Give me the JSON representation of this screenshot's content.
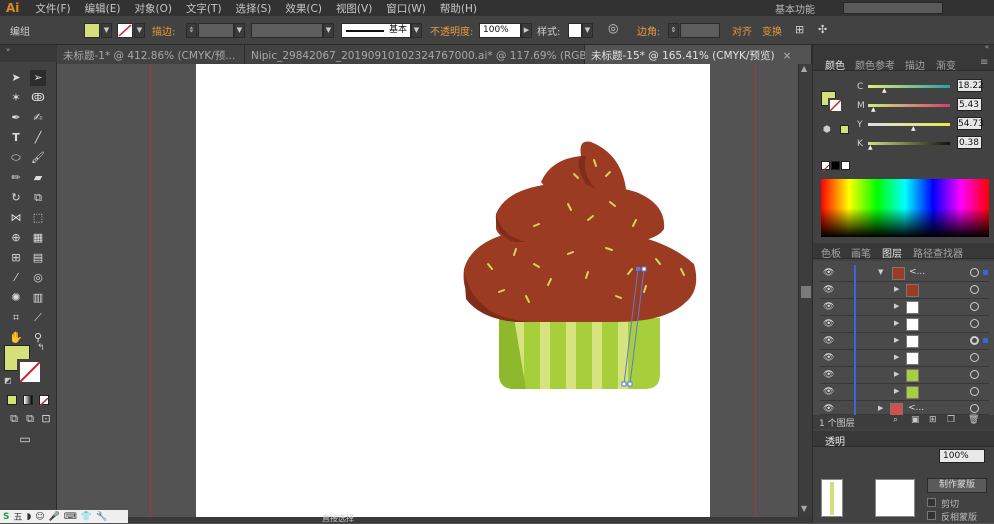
{
  "app": {
    "logo": "Ai",
    "workspace": "基本功能"
  },
  "menu": [
    "文件(F)",
    "编辑(E)",
    "对象(O)",
    "文字(T)",
    "选择(S)",
    "效果(C)",
    "视图(V)",
    "窗口(W)",
    "帮助(H)"
  ],
  "control": {
    "mode_label": "编组",
    "stroke_label": "描边:",
    "stroke_style": "基本",
    "opacity_label": "不透明度:",
    "opacity_value": "100%",
    "style_label": "样式:",
    "corner_label": "边角:",
    "align_label": "对齐",
    "transform_label": "变换"
  },
  "tabs": [
    {
      "label": "未标题-1* @ 412.86% (CMYK/预...",
      "active": false
    },
    {
      "label": "Nipic_29842067_20190910102324767000.ai* @ 117.69% (RGB/预...",
      "active": false
    },
    {
      "label": "未标题-15* @ 165.41% (CMYK/预览)",
      "active": true
    }
  ],
  "color_panel": {
    "tabs": [
      "颜色",
      "颜色参考",
      "描边",
      "渐变"
    ],
    "channels": [
      {
        "name": "C",
        "value": "18.22"
      },
      {
        "name": "M",
        "value": "5.43"
      },
      {
        "name": "Y",
        "value": "54.73"
      },
      {
        "name": "K",
        "value": "0.38"
      }
    ],
    "fill_color": "#d5e07a"
  },
  "layers_panel": {
    "tabs": [
      "色板",
      "画笔",
      "图层",
      "路径查找器"
    ],
    "group_label": "<...",
    "layer_count": "1 个图层",
    "bottom_layer_label": "<..."
  },
  "transparency_panel": {
    "tab": "透明",
    "opacity": "100%",
    "make_mask": "制作蒙版",
    "clip": "剪切",
    "invert_mask": "反相蒙版"
  },
  "status": {
    "selection_tool": "直接选择"
  },
  "taskbar": {
    "ime": "五"
  }
}
